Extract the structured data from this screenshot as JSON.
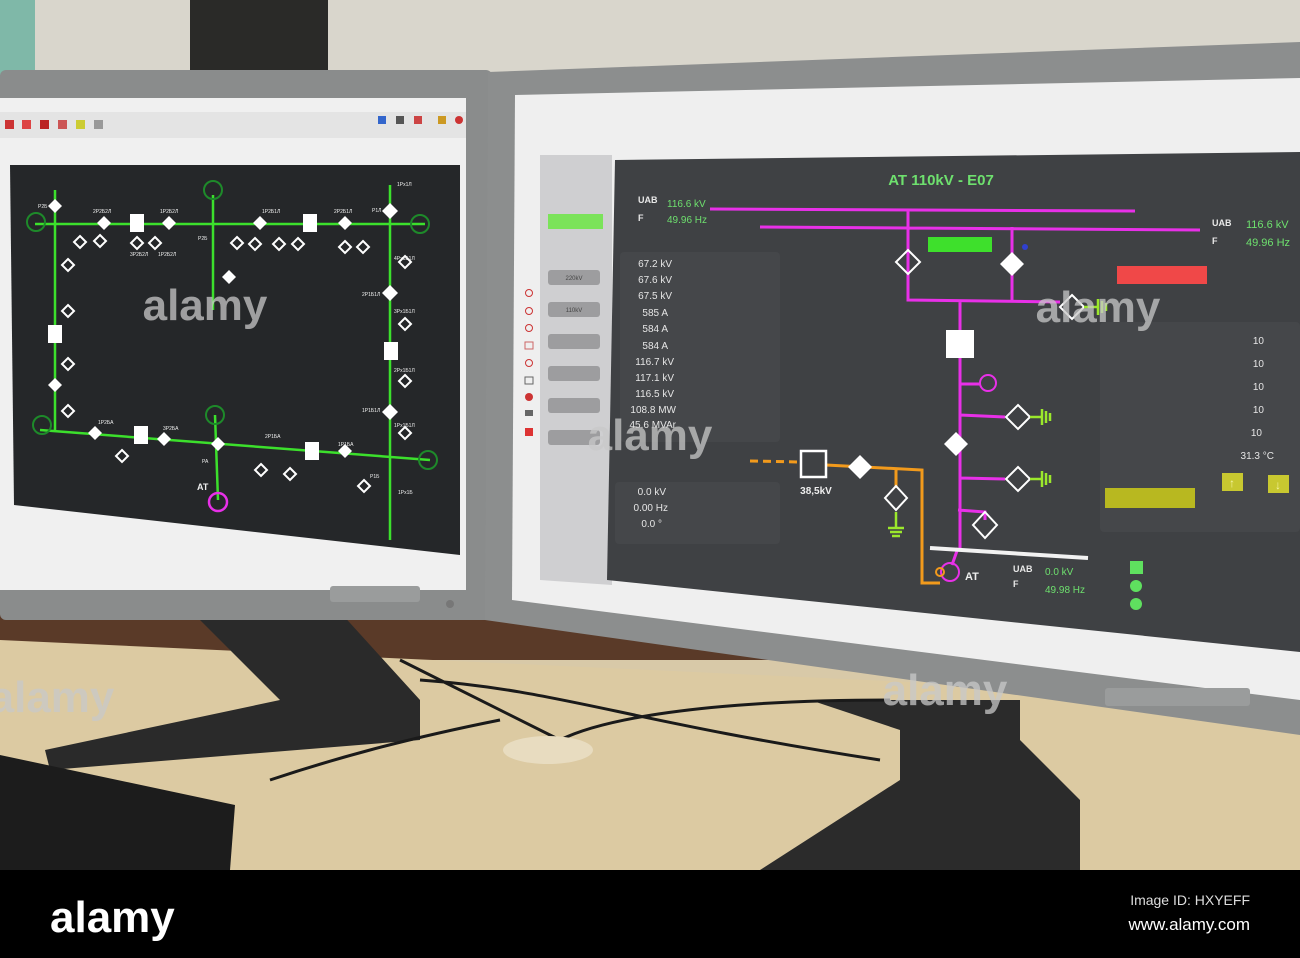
{
  "right_screen": {
    "title": "AT 110kV - E07",
    "top_left": {
      "u_label": "UAB",
      "u_value": "116.6 kV",
      "f_label": "F",
      "f_value": "49.96 Hz"
    },
    "top_right": {
      "u_label": "UAB",
      "u_value": "116.6 kV",
      "f_label": "F",
      "f_value": "49.96 Hz"
    },
    "bottom": {
      "u_label": "UAB",
      "u_value": "0.0 kV",
      "f_label": "F",
      "f_value": "49.98 Hz"
    },
    "measurements": [
      "67.2 kV",
      "67.6 kV",
      "67.5 kV",
      "585 A",
      "584 A",
      "584 A",
      "116.7 kV",
      "117.1 kV",
      "116.5 kV",
      "108.8 MW",
      "45.6 MVAr"
    ],
    "secondary_measurements": [
      "0.0 kV",
      "0.00 Hz",
      "0.0 °"
    ],
    "tap_values": [
      "10",
      "10",
      "10",
      "10",
      "10"
    ],
    "temperature": "31.3 °C",
    "voltage_label": "38,5kV",
    "transformer_label": "AT",
    "side_buttons": [
      "220kV",
      "110kV",
      "",
      "",
      "",
      ""
    ],
    "arrow_up": "↑",
    "arrow_down": "↓",
    "colors": {
      "bus_110": "#e830e8",
      "bus_35": "#f29a1c",
      "ok": "#6ee06e",
      "alarm": "#f04848",
      "warn": "#c8c830"
    }
  },
  "left_screen": {
    "labels": [
      "P2Б",
      "2P2Б2Л",
      "1P2Б2Л",
      "P2Б",
      "1P2Б1Л",
      "2P2Б1Л",
      "P1Л",
      "1Px1Л",
      "4Px1Б1Л",
      "2P1Б1Л",
      "3Px1Б1Л",
      "2Px1Б1Л",
      "1P1Б1Л",
      "1Px1Б1Л",
      "1P2БA",
      "3P2БA",
      "2P1БA",
      "1P1БA",
      "PA",
      "P1Б",
      "1Px1Б",
      "3P2Б2Л",
      "1P2Б2Л"
    ],
    "transformer_label": "AT"
  },
  "watermark": "alamy",
  "footer": {
    "logo": "alamy",
    "image_id": "Image ID: HXYEFF",
    "url": "www.alamy.com"
  }
}
